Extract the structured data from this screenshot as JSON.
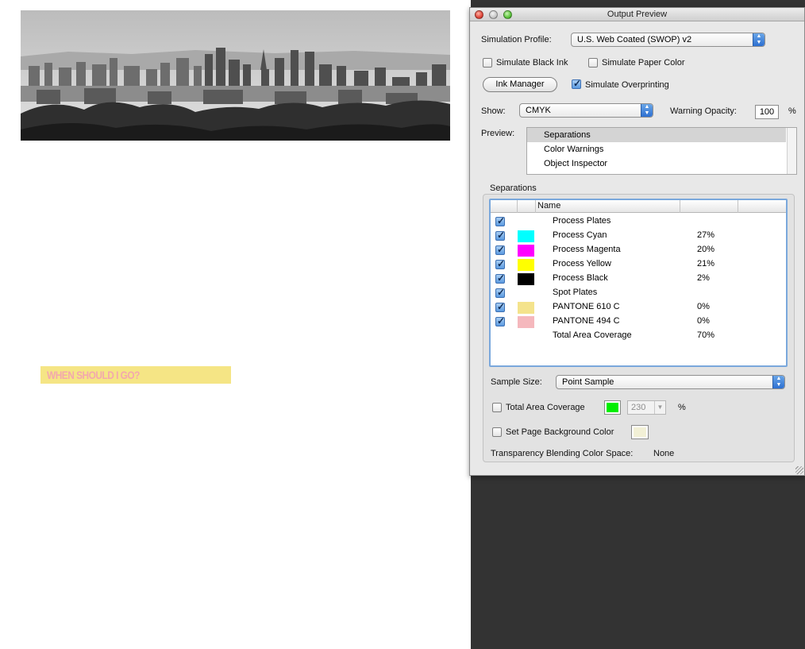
{
  "document": {
    "heading": "WHEN SHOULD I GO?",
    "heading_bg": "#f5e585",
    "heading_color": "#f3a8ad"
  },
  "panel": {
    "title": "Output Preview",
    "simulation_profile": {
      "label": "Simulation Profile:",
      "value": "U.S. Web Coated (SWOP) v2"
    },
    "simulate_black_ink": {
      "label": "Simulate Black Ink",
      "checked": false
    },
    "simulate_paper_color": {
      "label": "Simulate Paper Color",
      "checked": false
    },
    "ink_manager_label": "Ink Manager",
    "simulate_overprinting": {
      "label": "Simulate Overprinting",
      "checked": true
    },
    "show": {
      "label": "Show:",
      "value": "CMYK"
    },
    "warning_opacity": {
      "label": "Warning Opacity:",
      "value": "100",
      "unit": "%"
    },
    "preview": {
      "label": "Preview:",
      "items": [
        {
          "label": "Separations",
          "selected": true
        },
        {
          "label": "Color Warnings",
          "selected": false
        },
        {
          "label": "Object Inspector",
          "selected": false
        }
      ]
    },
    "separations": {
      "group_label": "Separations",
      "name_header": "Name",
      "rows": [
        {
          "name": "Process Plates",
          "checked": true,
          "color": "",
          "pct": ""
        },
        {
          "name": "Process Cyan",
          "checked": true,
          "color": "#00ffff",
          "pct": "27%"
        },
        {
          "name": "Process Magenta",
          "checked": true,
          "color": "#ff00ff",
          "pct": "20%"
        },
        {
          "name": "Process Yellow",
          "checked": true,
          "color": "#ffff00",
          "pct": "21%"
        },
        {
          "name": "Process Black",
          "checked": true,
          "color": "#000000",
          "pct": "2%"
        },
        {
          "name": "Spot Plates",
          "checked": true,
          "color": "",
          "pct": ""
        },
        {
          "name": "PANTONE 610 C",
          "checked": true,
          "color": "#f4e38c",
          "pct": "0%"
        },
        {
          "name": "PANTONE 494 C",
          "checked": true,
          "color": "#f5b8bd",
          "pct": "0%"
        },
        {
          "name": "Total Area Coverage",
          "checked": null,
          "color": "",
          "pct": "70%"
        }
      ]
    },
    "sample_size": {
      "label": "Sample Size:",
      "value": "Point Sample"
    },
    "total_area_coverage": {
      "label": "Total Area Coverage",
      "checked": false,
      "color": "#00ee00",
      "value": "230",
      "unit": "%"
    },
    "page_background": {
      "label": "Set Page Background Color",
      "checked": false,
      "color": "#f2f0d6"
    },
    "transparency": {
      "label": "Transparency Blending Color Space:",
      "value": "None"
    }
  }
}
